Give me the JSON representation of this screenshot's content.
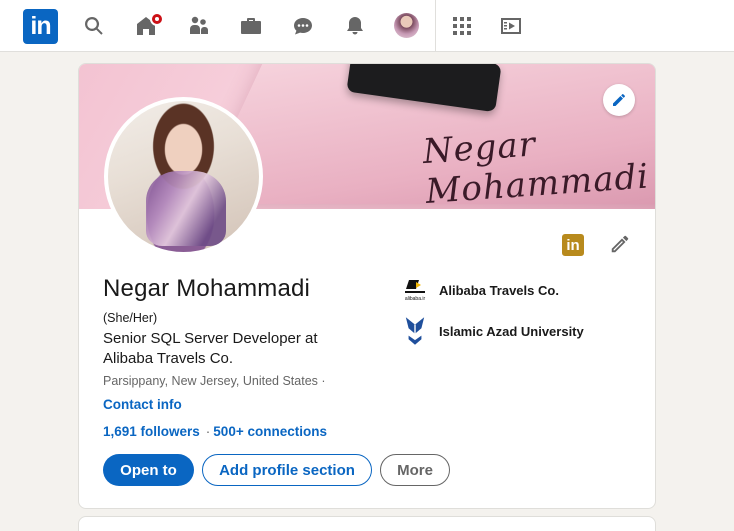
{
  "nav": {
    "logo_text": "in",
    "icons": [
      "search-icon",
      "home-icon",
      "my-network-icon",
      "jobs-icon",
      "messaging-icon",
      "notifications-icon",
      "me-avatar",
      "apps-grid-icon",
      "video-icon"
    ]
  },
  "banner": {
    "signature": "Negar Mohammadi"
  },
  "profile": {
    "name": "Negar Mohammadi",
    "pronouns": "(She/Her)",
    "headline": "Senior SQL Server Developer at Alibaba Travels Co.",
    "location": "Parsippany, New Jersey, United States ·",
    "contact_info": "Contact info",
    "followers": "1,691 followers",
    "stats_separator": "·",
    "connections": "500+ connections"
  },
  "organizations": [
    {
      "name": "Alibaba Travels Co.",
      "logo_text": "alibaba.ir"
    },
    {
      "name": "Islamic Azad University",
      "logo_text": ""
    }
  ],
  "actions": {
    "open_to": "Open to",
    "add_section": "Add profile section",
    "more": "More"
  },
  "colors": {
    "brand": "#0a66c2",
    "notification": "#cc1016",
    "premium_icon": "#b88a1d"
  }
}
